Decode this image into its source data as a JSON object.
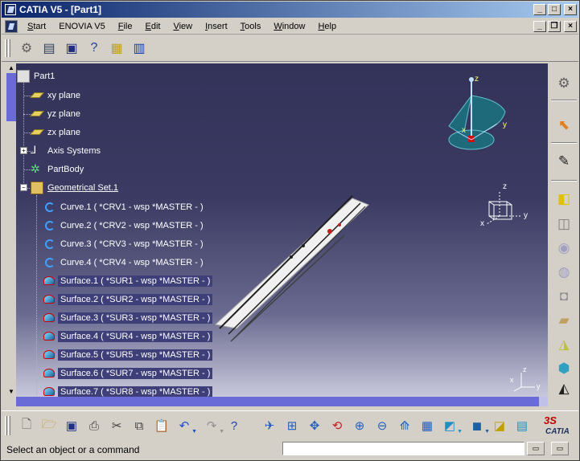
{
  "window": {
    "title": "CATIA V5 - [Part1]",
    "min": "_",
    "max": "□",
    "close": "×"
  },
  "mdi": {
    "min": "_",
    "restore": "❐",
    "close": "×"
  },
  "menus": [
    {
      "label": "Start",
      "key": "S"
    },
    {
      "label": "ENOVIA V5",
      "key": ""
    },
    {
      "label": "File",
      "key": "F"
    },
    {
      "label": "Edit",
      "key": "E"
    },
    {
      "label": "View",
      "key": "V"
    },
    {
      "label": "Insert",
      "key": "I"
    },
    {
      "label": "Tools",
      "key": "T"
    },
    {
      "label": "Window",
      "key": "W"
    },
    {
      "label": "Help",
      "key": "H"
    }
  ],
  "tree": {
    "root": "Part1",
    "planes": [
      "xy plane",
      "yz plane",
      "zx plane"
    ],
    "axis_systems": "Axis Systems",
    "part_body": "PartBody",
    "geom_set": "Geometrical Set.1",
    "curves": [
      "Curve.1 ( *CRV1 - wsp *MASTER -  )",
      "Curve.2 ( *CRV2 - wsp *MASTER -  )",
      "Curve.3 ( *CRV3 - wsp *MASTER -  )",
      "Curve.4 ( *CRV4 - wsp *MASTER -  )"
    ],
    "surfaces": [
      "Surface.1 ( *SUR1 - wsp *MASTER -  )",
      "Surface.2 ( *SUR2 - wsp *MASTER -  )",
      "Surface.3 ( *SUR3 - wsp *MASTER -  )",
      "Surface.4 ( *SUR4 - wsp *MASTER -  )",
      "Surface.5 ( *SUR5 - wsp *MASTER -  )",
      "Surface.6 ( *SUR7 - wsp *MASTER -  )",
      "Surface.7 ( *SUR8 - wsp *MASTER -  )"
    ]
  },
  "compass": {
    "x": "x",
    "y": "y",
    "z": "z"
  },
  "axis3d": {
    "x": "x",
    "y": "y",
    "z": "z"
  },
  "corner_axis": {
    "x": "x",
    "y": "y",
    "z": "z"
  },
  "status": {
    "message": "Select an object or a command"
  },
  "logo": {
    "brand": "CATIA"
  },
  "colors": {
    "viewport_top": "#33335a",
    "viewport_bottom": "#c8c8dc",
    "selection": "#3e3e78",
    "titlebar": "#0a246a"
  }
}
